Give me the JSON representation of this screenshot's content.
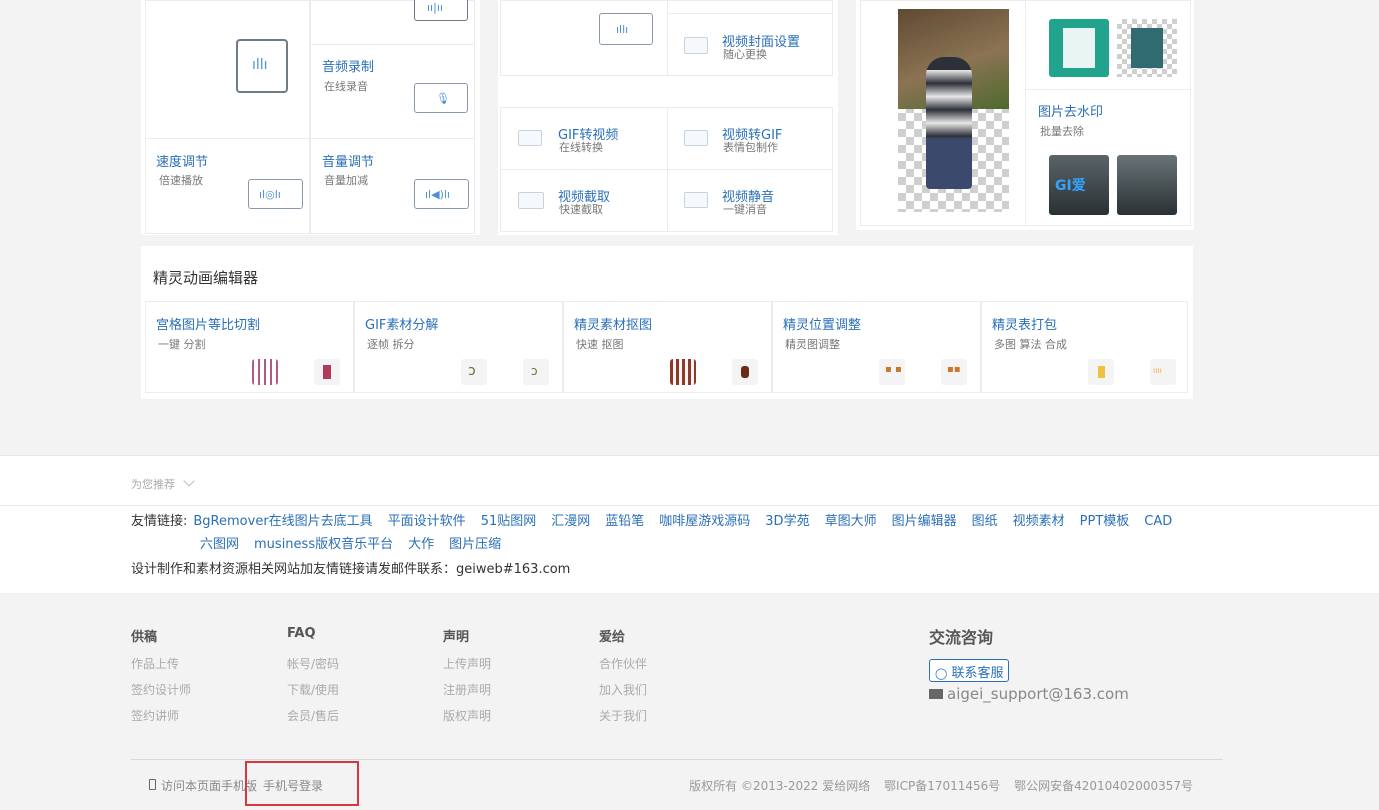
{
  "audio_tools": [
    {
      "title": "音频录制",
      "sub": "在线录音"
    },
    {
      "title": "速度调节",
      "sub": "倍速播放"
    },
    {
      "title": "音量调节",
      "sub": "音量加减"
    }
  ],
  "video_tools": [
    {
      "title": "视频封面设置",
      "sub": "随心更换"
    },
    {
      "title": "GIF转视频",
      "sub": "在线转换"
    },
    {
      "title": "视频转GIF",
      "sub": "表情包制作"
    },
    {
      "title": "视频截取",
      "sub": "快速截取"
    },
    {
      "title": "视频静音",
      "sub": "一键消音"
    }
  ],
  "image_tools": [
    {
      "title": "图片去水印",
      "sub": "批量去除"
    }
  ],
  "sprite_section": {
    "heading": "精灵动画编辑器",
    "items": [
      {
        "title": "宫格图片等比切割",
        "sub": "一键 分割"
      },
      {
        "title": "GIF素材分解",
        "sub": "逐帧 拆分"
      },
      {
        "title": "精灵素材抠图",
        "sub": "快速 抠图"
      },
      {
        "title": "精灵位置调整",
        "sub": "精灵图调整"
      },
      {
        "title": "精灵表打包",
        "sub": "多图 算法 合成"
      }
    ]
  },
  "recommend": {
    "label": "为您推荐"
  },
  "friend_links": {
    "label": "友情链接:",
    "row1": [
      "BgRemover在线图片去底工具",
      "平面设计软件",
      "51贴图网",
      "汇漫网",
      "蓝铅笔",
      "咖啡屋游戏源码",
      "3D学苑",
      "草图大师",
      "图片编辑器",
      "图纸",
      "视频素材",
      "PPT模板",
      "CAD"
    ],
    "row2": [
      "六图网",
      "musiness版权音乐平台",
      "大作",
      "图片压缩"
    ],
    "note": "设计制作和素材资源相关网站加友情链接请发邮件联系：geiweb#163.com"
  },
  "footer": {
    "cols": [
      {
        "head": "供稿",
        "links": [
          "作品上传",
          "签约设计师",
          "签约讲师"
        ]
      },
      {
        "head": "FAQ",
        "links": [
          "帐号/密码",
          "下载/使用",
          "会员/售后"
        ]
      },
      {
        "head": "声明",
        "links": [
          "上传声明",
          "注册声明",
          "版权声明"
        ]
      },
      {
        "head": "爱给",
        "links": [
          "合作伙伴",
          "加入我们",
          "关于我们"
        ]
      }
    ],
    "contact": {
      "head": "交流咨询",
      "service_btn": "联系客服",
      "email": "aigei_support@163.com"
    },
    "bottom_left": {
      "mobile": "访问本页面手机版",
      "phone_login": "手机号登录"
    },
    "bottom_right": {
      "copyright": "版权所有 ©2013-2022  爱给网络",
      "icp": "鄂ICP备17011456号",
      "police": "鄂公网安备42010402000357号"
    }
  },
  "colors": {
    "link": "#2a6fb8",
    "highlight": "#d9363e",
    "bg": "#f3f3f3"
  }
}
